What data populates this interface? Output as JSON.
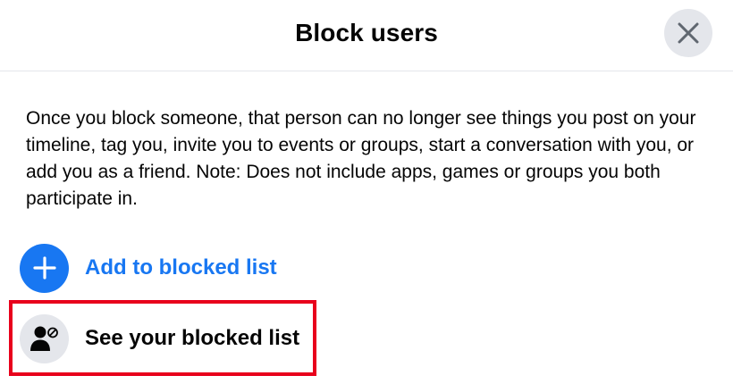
{
  "dialog": {
    "title": "Block users",
    "close_icon": "close-icon"
  },
  "description": "Once you block someone, that person can no longer see things you post on your timeline, tag you, invite you to events or groups, start a conversation with you, or add you as a friend. Note: Does not include apps, games or groups you both participate in.",
  "actions": {
    "add": {
      "label": "Add to blocked list",
      "icon": "plus-icon"
    },
    "see": {
      "label": "See your blocked list",
      "icon": "blocked-user-icon"
    }
  },
  "colors": {
    "accent": "#1877f2",
    "icon_bg": "#e4e6eb",
    "highlight": "#e8001c",
    "text": "#050505"
  }
}
